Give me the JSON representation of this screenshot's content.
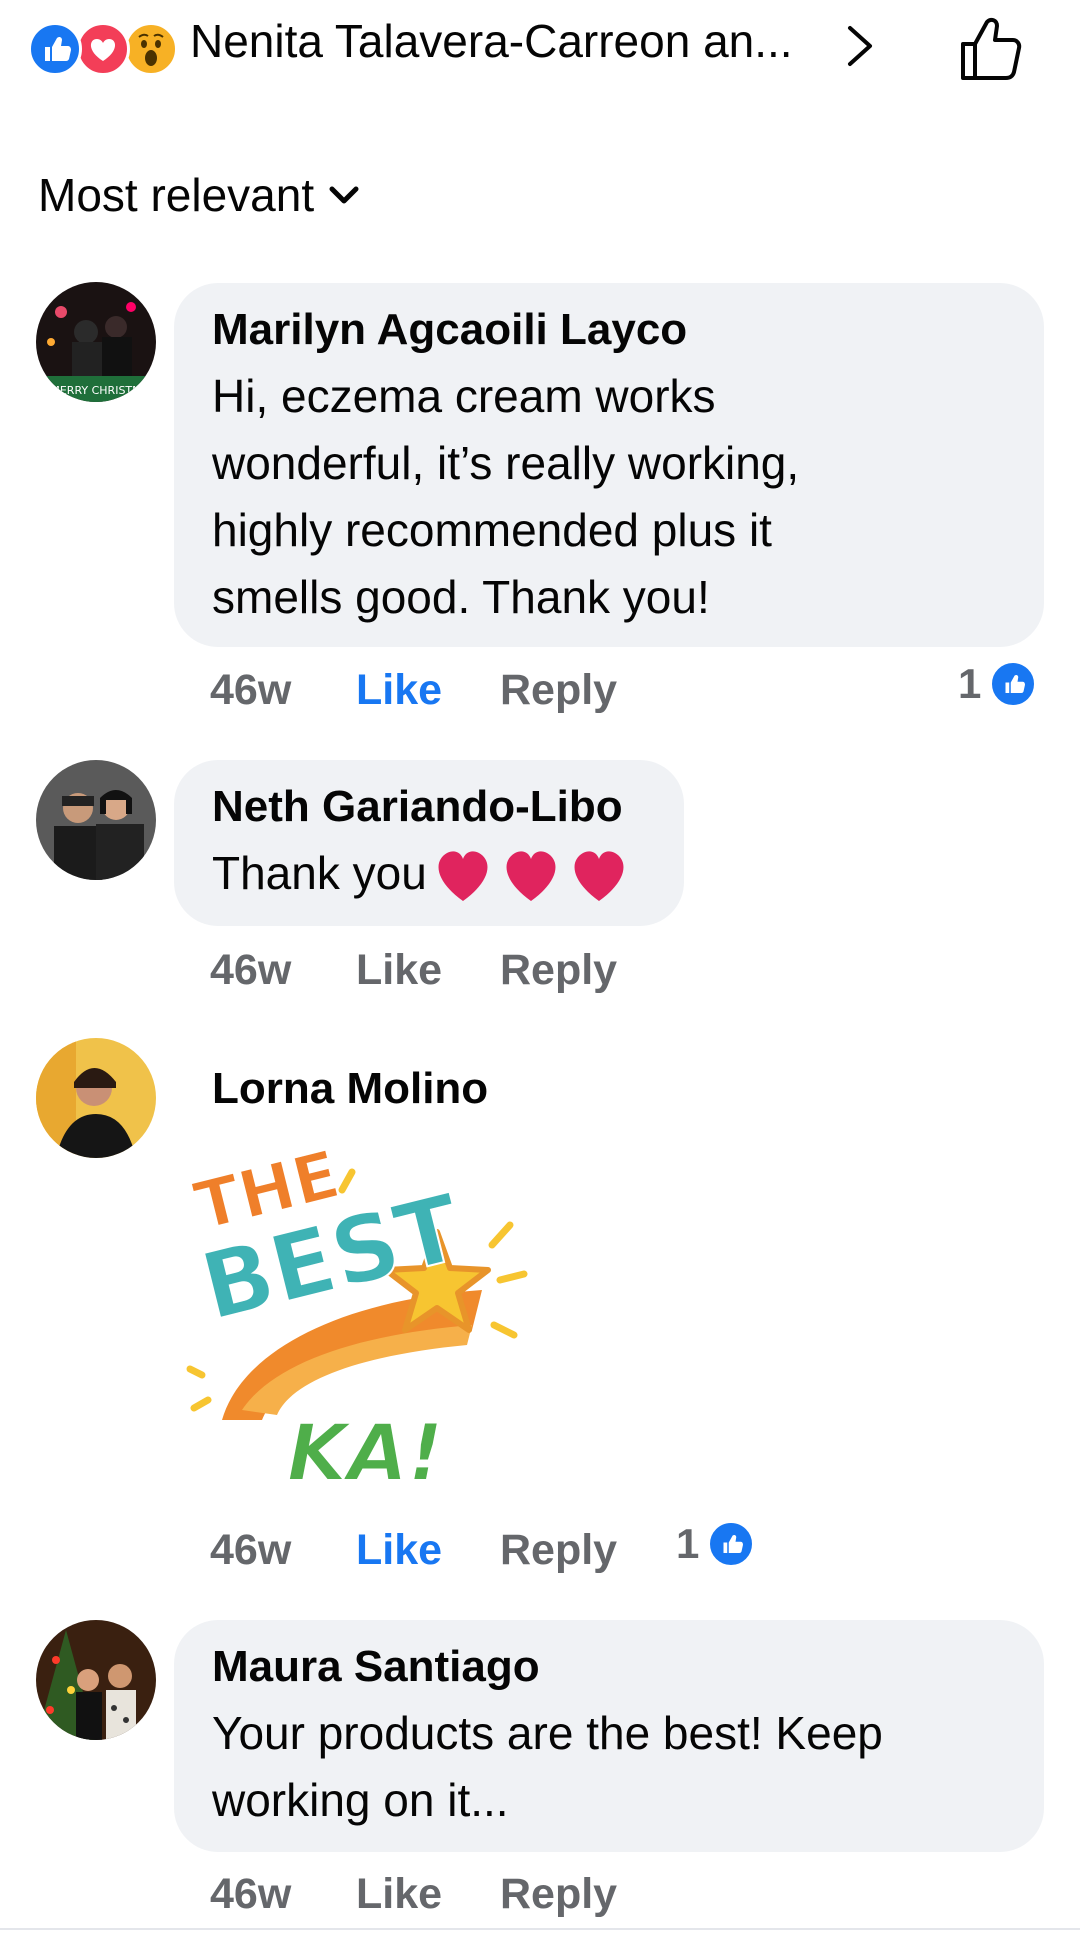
{
  "header": {
    "reactions": [
      "like-icon",
      "love-icon",
      "wow-icon"
    ],
    "names": "Nenita Talavera-Carreon an...",
    "more_icon": "chevron-right-icon",
    "like_icon": "thumbs-up-outline-icon"
  },
  "sort": {
    "label": "Most relevant",
    "icon": "chevron-down-icon"
  },
  "comments": [
    {
      "name": "Marilyn Agcaoili Layco",
      "lines": [
        "Hi, eczema cream works",
        "wonderful, it’s really working,",
        "highly recommended plus it",
        "smells good. Thank you!"
      ],
      "avatar_text": "MERRY CHRISTM",
      "time": "46w",
      "like": "Like",
      "reply": "Reply",
      "like_count": "1",
      "liked": true
    },
    {
      "name": "Neth Gariando-Libo",
      "text": "Thank you",
      "time": "46w",
      "like": "Like",
      "reply": "Reply",
      "liked": false
    },
    {
      "name": "Lorna Molino",
      "sticker": {
        "line1": "THE",
        "line2": "BEST",
        "line3": "KA!"
      },
      "time": "46w",
      "like": "Like",
      "reply": "Reply",
      "like_count": "1",
      "liked": true
    },
    {
      "name": "Maura Santiago",
      "lines": [
        "Your products are the best! Keep",
        "working on it..."
      ],
      "time": "46w",
      "like": "Like",
      "reply": "Reply",
      "liked": false
    }
  ],
  "colors": {
    "facebook_blue": "#1877f2",
    "bubble_bg": "#f0f2f5",
    "meta_grey": "#65676b",
    "heart_red": "#e0245e"
  }
}
